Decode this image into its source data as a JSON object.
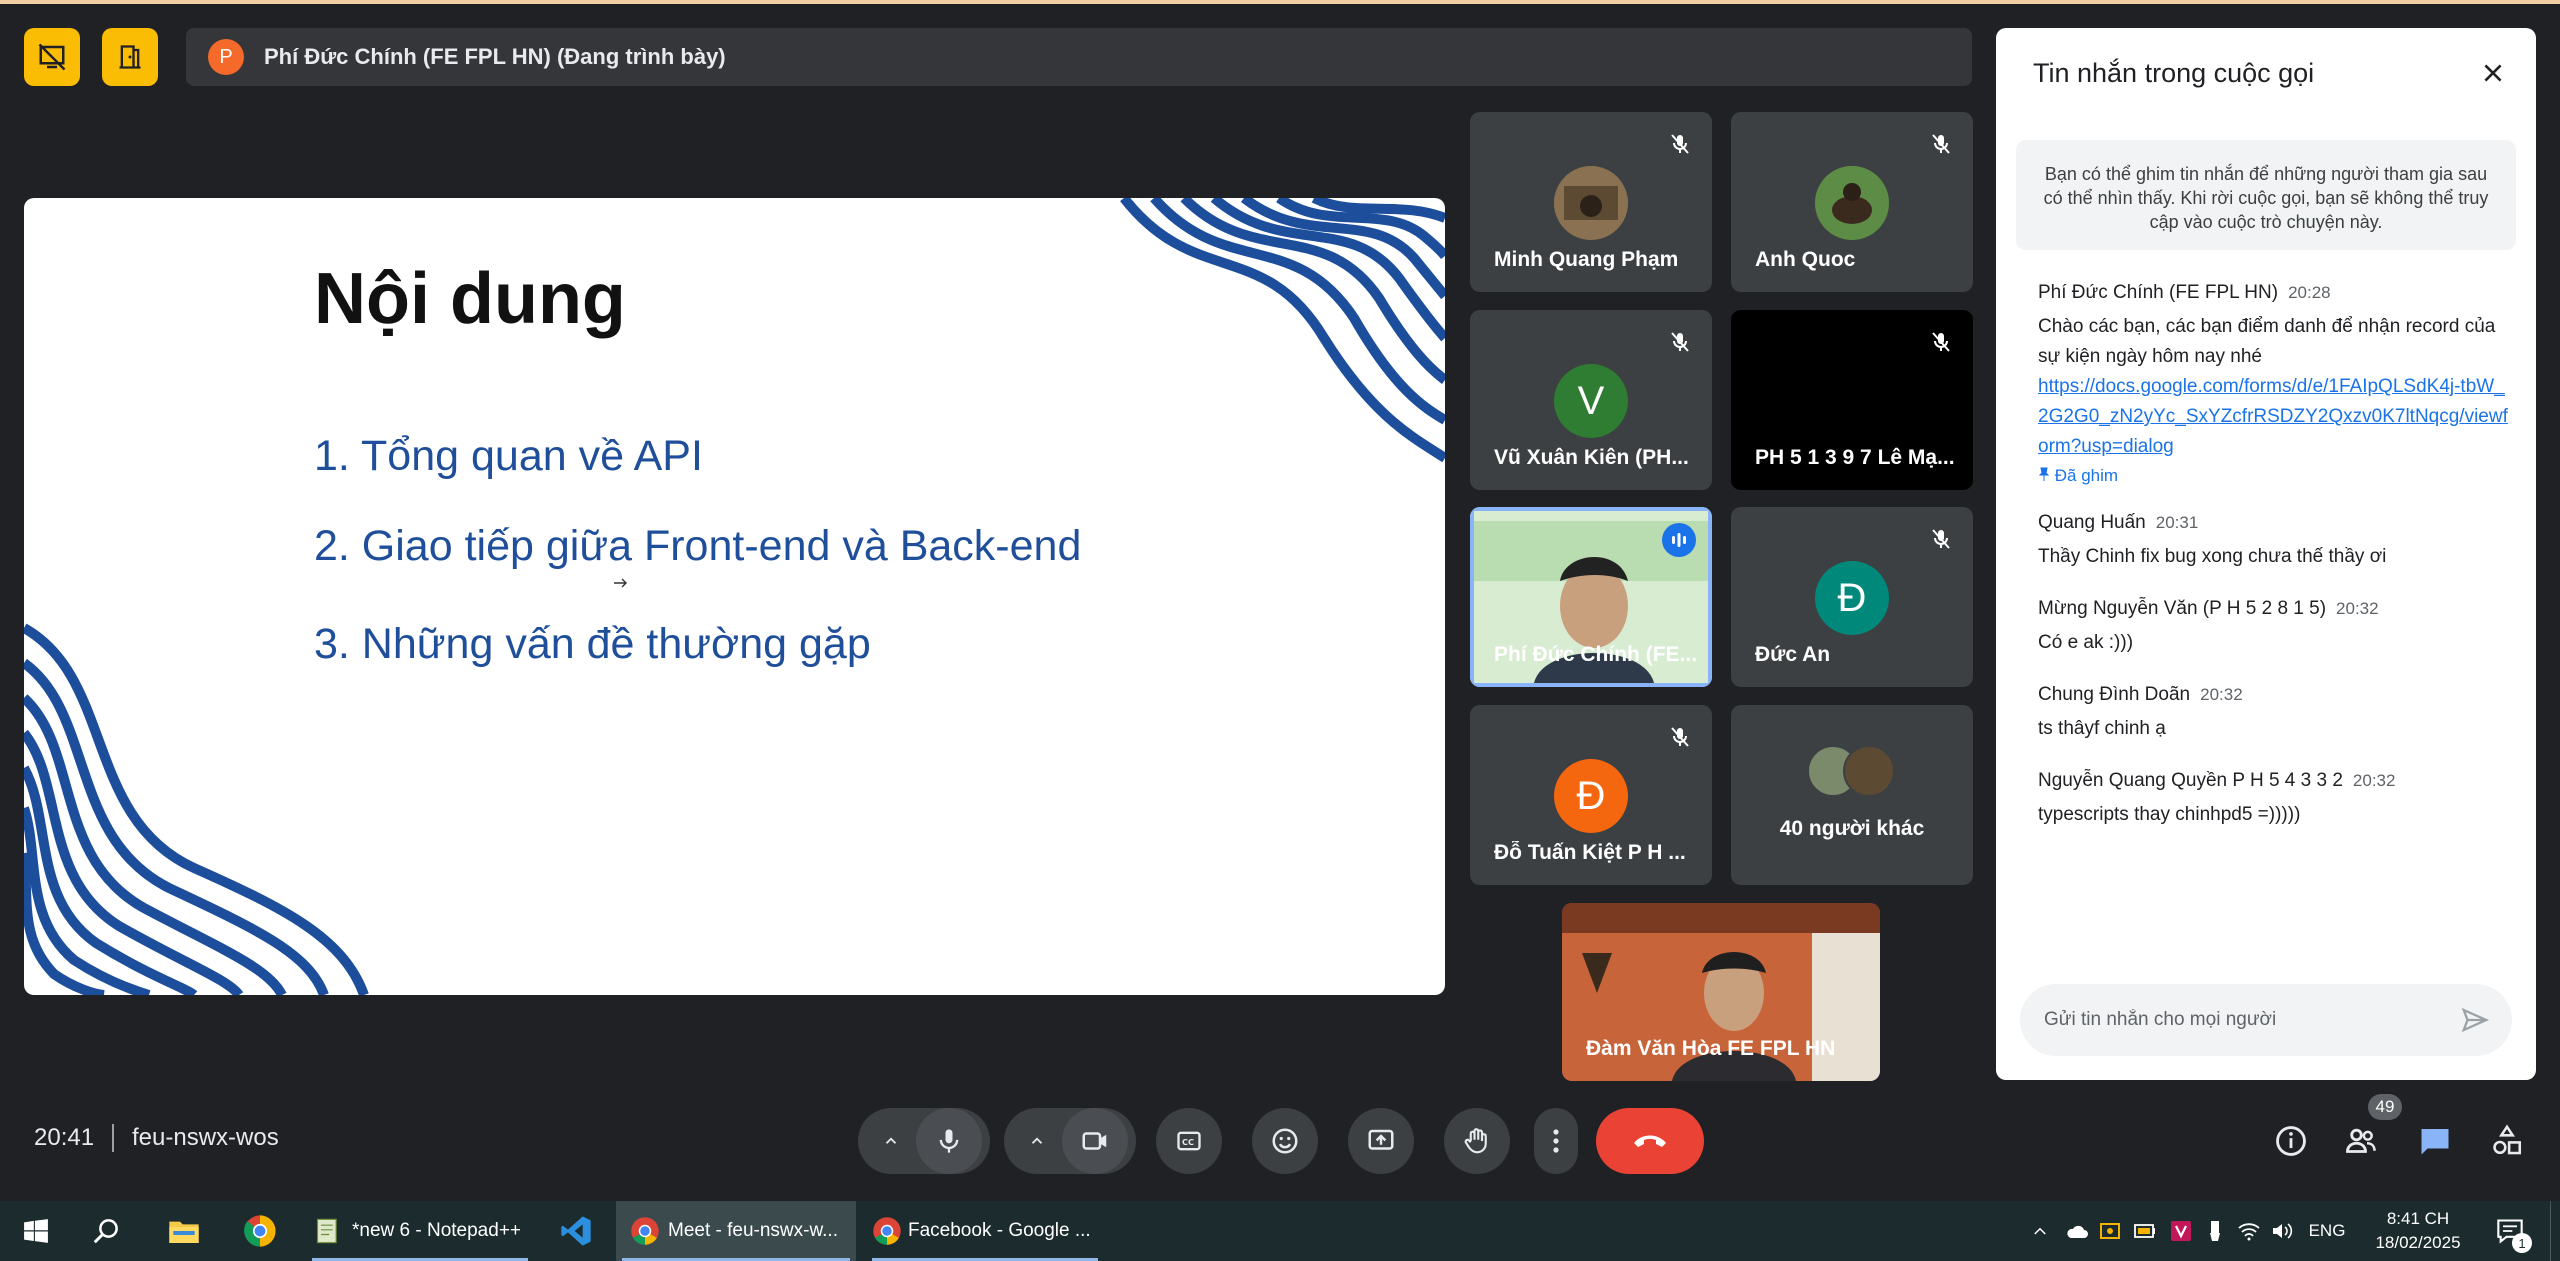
{
  "header": {
    "presenter_initial": "P",
    "presenting_text": "Phí Đức Chính (FE FPL HN) (Đang trình bày)"
  },
  "slide": {
    "title": "Nội dung",
    "items": [
      "1. Tổng quan về API",
      "2. Giao tiếp giữa Front-end và Back-end",
      "3. Những vấn đề thường gặp"
    ]
  },
  "tiles": [
    {
      "name": "Minh Quang Phạm",
      "initial": "",
      "muted": true
    },
    {
      "name": "Anh Quoc",
      "initial": "",
      "muted": true
    },
    {
      "name": "Vũ Xuân Kiên (PH...",
      "initial": "V",
      "muted": true
    },
    {
      "name": "PH 5 1 3 9 7 Lê Mạ...",
      "initial": "",
      "muted": true
    },
    {
      "name": "Phí Đức Chính (FE...",
      "initial": "",
      "muted": false,
      "speaking": true
    },
    {
      "name": "Đức An",
      "initial": "Đ",
      "muted": true
    },
    {
      "name": "Đỗ Tuấn Kiệt P H ...",
      "initial": "Đ",
      "muted": true
    },
    {
      "name": "40 người khác",
      "initial": "",
      "muted": false
    },
    {
      "name": "Đàm Văn Hòa FE FPL HN",
      "initial": "",
      "muted": false
    }
  ],
  "colors": {
    "tile_bg": "#3c4043",
    "speaking_border": "#8ab4f8",
    "avatar_green": "#2e7d32",
    "avatar_teal": "#00897b",
    "avatar_orange": "#f4670f",
    "end_call": "#ea4335",
    "link": "#1a73e8"
  },
  "chat": {
    "title": "Tin nhắn trong cuộc gọi",
    "info": "Bạn có thể ghim tin nhắn để những người tham gia sau có thể nhìn thấy. Khi rời cuộc gọi, bạn sẽ không thể truy cập vào cuộc trò chuyện này.",
    "messages": [
      {
        "sender": "Phí Đức Chính (FE FPL HN)",
        "time": "20:28",
        "text": "Chào các bạn, các bạn điểm danh để nhận record của sự kiện ngày hôm nay nhé",
        "link": "https://docs.google.com/forms/d/e/1FAIpQLSdK4j-tbW_2G2G0_zN2yYc_SxYZcfrRSDZY2Qxzv0K7ltNqcg/viewform?usp=dialog",
        "pinned": "Đã ghim"
      },
      {
        "sender": "Quang Huấn",
        "time": "20:31",
        "text": "Thầy Chinh fix bug xong chưa thế thầy ơi"
      },
      {
        "sender": "Mừng Nguyễn Văn (P H 5 2 8 1 5)",
        "time": "20:32",
        "text": "Có e ak :)))"
      },
      {
        "sender": "Chung Đình Doãn",
        "time": "20:32",
        "text": "ts thâyf chinh ạ"
      },
      {
        "sender": "Nguyễn Quang Quyền P H 5 4 3 3 2",
        "time": "20:32",
        "text": "typescripts thay chinhpd5 =)))))"
      }
    ],
    "input_placeholder": "Gửi tin nhắn cho mọi người"
  },
  "bottom": {
    "time": "20:41",
    "meeting_code": "feu-nswx-wos",
    "people_count": "49"
  },
  "taskbar": {
    "apps": [
      {
        "label": "*new 6 - Notepad++"
      },
      {
        "label": "Meet - feu-nswx-w..."
      },
      {
        "label": "Facebook - Google ..."
      }
    ],
    "lang": "ENG",
    "time": "8:41 CH",
    "date": "18/02/2025",
    "notif_count": "1"
  }
}
